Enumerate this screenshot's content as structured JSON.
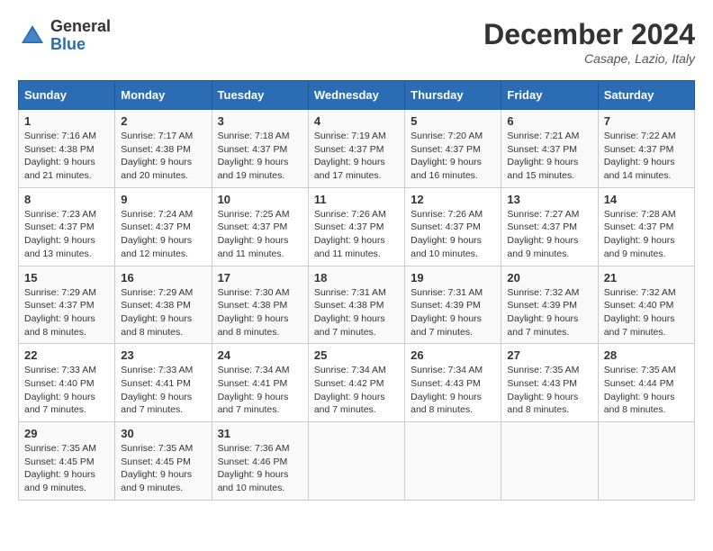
{
  "header": {
    "logo_general": "General",
    "logo_blue": "Blue",
    "month_title": "December 2024",
    "location": "Casape, Lazio, Italy"
  },
  "weekdays": [
    "Sunday",
    "Monday",
    "Tuesday",
    "Wednesday",
    "Thursday",
    "Friday",
    "Saturday"
  ],
  "weeks": [
    [
      {
        "day": "1",
        "sunrise": "7:16 AM",
        "sunset": "4:38 PM",
        "daylight": "9 hours and 21 minutes."
      },
      {
        "day": "2",
        "sunrise": "7:17 AM",
        "sunset": "4:38 PM",
        "daylight": "9 hours and 20 minutes."
      },
      {
        "day": "3",
        "sunrise": "7:18 AM",
        "sunset": "4:37 PM",
        "daylight": "9 hours and 19 minutes."
      },
      {
        "day": "4",
        "sunrise": "7:19 AM",
        "sunset": "4:37 PM",
        "daylight": "9 hours and 17 minutes."
      },
      {
        "day": "5",
        "sunrise": "7:20 AM",
        "sunset": "4:37 PM",
        "daylight": "9 hours and 16 minutes."
      },
      {
        "day": "6",
        "sunrise": "7:21 AM",
        "sunset": "4:37 PM",
        "daylight": "9 hours and 15 minutes."
      },
      {
        "day": "7",
        "sunrise": "7:22 AM",
        "sunset": "4:37 PM",
        "daylight": "9 hours and 14 minutes."
      }
    ],
    [
      {
        "day": "8",
        "sunrise": "7:23 AM",
        "sunset": "4:37 PM",
        "daylight": "9 hours and 13 minutes."
      },
      {
        "day": "9",
        "sunrise": "7:24 AM",
        "sunset": "4:37 PM",
        "daylight": "9 hours and 12 minutes."
      },
      {
        "day": "10",
        "sunrise": "7:25 AM",
        "sunset": "4:37 PM",
        "daylight": "9 hours and 11 minutes."
      },
      {
        "day": "11",
        "sunrise": "7:26 AM",
        "sunset": "4:37 PM",
        "daylight": "9 hours and 11 minutes."
      },
      {
        "day": "12",
        "sunrise": "7:26 AM",
        "sunset": "4:37 PM",
        "daylight": "9 hours and 10 minutes."
      },
      {
        "day": "13",
        "sunrise": "7:27 AM",
        "sunset": "4:37 PM",
        "daylight": "9 hours and 9 minutes."
      },
      {
        "day": "14",
        "sunrise": "7:28 AM",
        "sunset": "4:37 PM",
        "daylight": "9 hours and 9 minutes."
      }
    ],
    [
      {
        "day": "15",
        "sunrise": "7:29 AM",
        "sunset": "4:37 PM",
        "daylight": "9 hours and 8 minutes."
      },
      {
        "day": "16",
        "sunrise": "7:29 AM",
        "sunset": "4:38 PM",
        "daylight": "9 hours and 8 minutes."
      },
      {
        "day": "17",
        "sunrise": "7:30 AM",
        "sunset": "4:38 PM",
        "daylight": "9 hours and 8 minutes."
      },
      {
        "day": "18",
        "sunrise": "7:31 AM",
        "sunset": "4:38 PM",
        "daylight": "9 hours and 7 minutes."
      },
      {
        "day": "19",
        "sunrise": "7:31 AM",
        "sunset": "4:39 PM",
        "daylight": "9 hours and 7 minutes."
      },
      {
        "day": "20",
        "sunrise": "7:32 AM",
        "sunset": "4:39 PM",
        "daylight": "9 hours and 7 minutes."
      },
      {
        "day": "21",
        "sunrise": "7:32 AM",
        "sunset": "4:40 PM",
        "daylight": "9 hours and 7 minutes."
      }
    ],
    [
      {
        "day": "22",
        "sunrise": "7:33 AM",
        "sunset": "4:40 PM",
        "daylight": "9 hours and 7 minutes."
      },
      {
        "day": "23",
        "sunrise": "7:33 AM",
        "sunset": "4:41 PM",
        "daylight": "9 hours and 7 minutes."
      },
      {
        "day": "24",
        "sunrise": "7:34 AM",
        "sunset": "4:41 PM",
        "daylight": "9 hours and 7 minutes."
      },
      {
        "day": "25",
        "sunrise": "7:34 AM",
        "sunset": "4:42 PM",
        "daylight": "9 hours and 7 minutes."
      },
      {
        "day": "26",
        "sunrise": "7:34 AM",
        "sunset": "4:43 PM",
        "daylight": "9 hours and 8 minutes."
      },
      {
        "day": "27",
        "sunrise": "7:35 AM",
        "sunset": "4:43 PM",
        "daylight": "9 hours and 8 minutes."
      },
      {
        "day": "28",
        "sunrise": "7:35 AM",
        "sunset": "4:44 PM",
        "daylight": "9 hours and 8 minutes."
      }
    ],
    [
      {
        "day": "29",
        "sunrise": "7:35 AM",
        "sunset": "4:45 PM",
        "daylight": "9 hours and 9 minutes."
      },
      {
        "day": "30",
        "sunrise": "7:35 AM",
        "sunset": "4:45 PM",
        "daylight": "9 hours and 9 minutes."
      },
      {
        "day": "31",
        "sunrise": "7:36 AM",
        "sunset": "4:46 PM",
        "daylight": "9 hours and 10 minutes."
      },
      null,
      null,
      null,
      null
    ]
  ],
  "labels": {
    "sunrise": "Sunrise:",
    "sunset": "Sunset:",
    "daylight": "Daylight:"
  }
}
